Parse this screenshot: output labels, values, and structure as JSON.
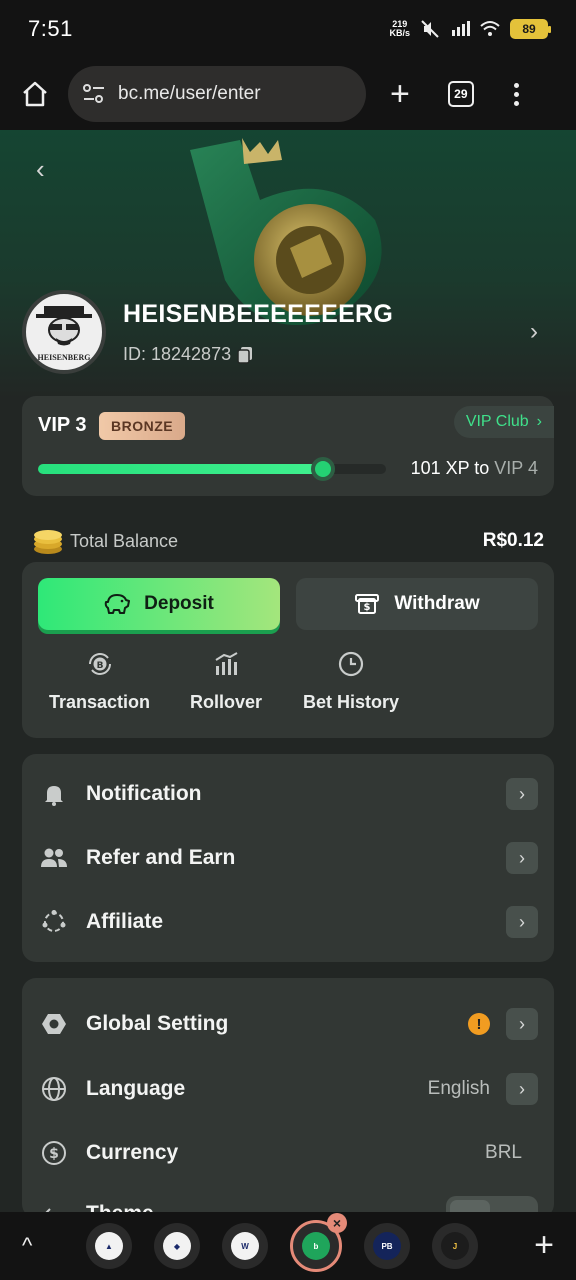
{
  "status_bar": {
    "time": "7:51",
    "net_speed_top": "219",
    "net_speed_unit": "KB/s",
    "battery": "89"
  },
  "browser": {
    "url": "bc.me/user/enter",
    "tab_count": "29"
  },
  "profile": {
    "username": "HEISENBEEEEEEERG",
    "id_label": "ID: 18242873",
    "avatar_text": "HEISENBERG"
  },
  "vip": {
    "level": "VIP 3",
    "tier": "BRONZE",
    "club_link": "VIP Club",
    "progress": 0.82,
    "xp": "101 XP to ",
    "next_level": "VIP 4"
  },
  "balance": {
    "label": "Total Balance",
    "value": "R$0.12"
  },
  "actions": {
    "deposit": "Deposit",
    "withdraw": "Withdraw"
  },
  "quick_links": [
    {
      "label": "Transaction"
    },
    {
      "label": "Rollover"
    },
    {
      "label": "Bet History"
    }
  ],
  "menu1": [
    {
      "label": "Notification",
      "icon": "bell-icon"
    },
    {
      "label": "Refer and Earn",
      "icon": "users-icon"
    },
    {
      "label": "Affiliate",
      "icon": "affiliate-icon"
    }
  ],
  "menu2": [
    {
      "label": "Global Setting",
      "icon": "settings-hex-icon",
      "warning": "!"
    },
    {
      "label": "Language",
      "icon": "globe-icon",
      "value": "English"
    },
    {
      "label": "Currency",
      "icon": "currency-icon",
      "value": "BRL"
    },
    {
      "label": "Theme",
      "icon": "theme-icon"
    }
  ],
  "colors": {
    "accent": "#2ee878",
    "card": "#323734",
    "background": "#222624"
  }
}
